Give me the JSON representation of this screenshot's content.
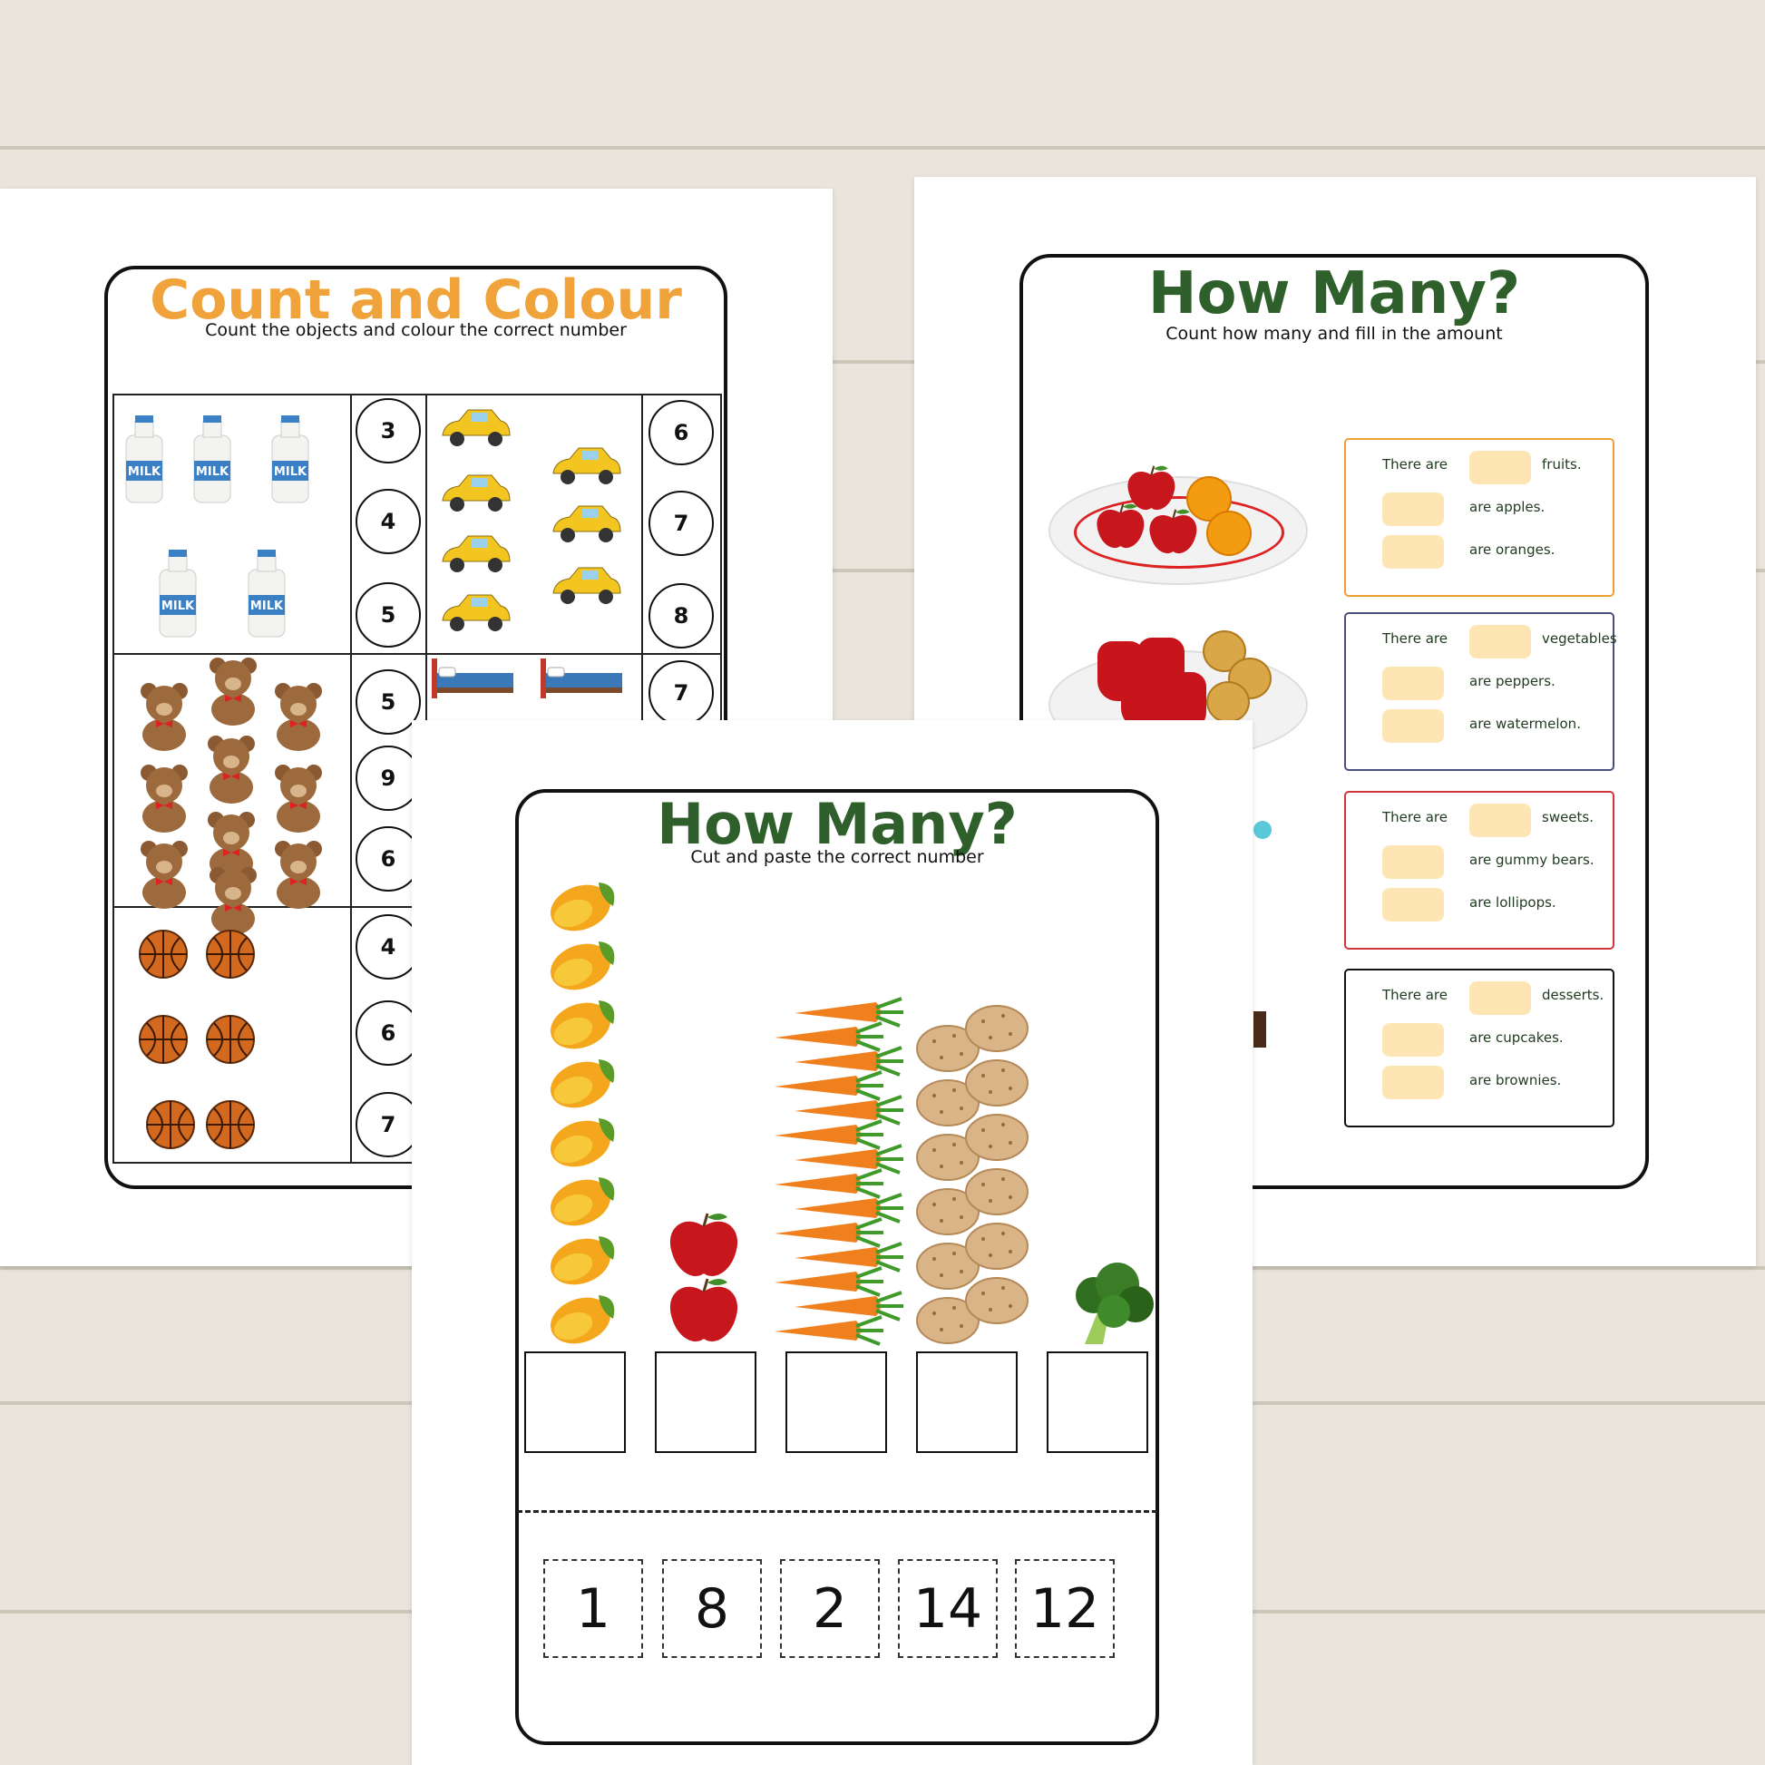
{
  "colors": {
    "orange_title": "#f0a33a",
    "green_title": "#2f5f2b",
    "box_orange": "#f0a030",
    "box_navy": "#4a4e7a",
    "box_red": "#d0343c",
    "box_black": "#111111",
    "pill": "#fde6b3"
  },
  "left_sheet": {
    "title": "Count and Colour",
    "subtitle": "Count the objects and colour the correct number",
    "rows": [
      {
        "left_item": "milk",
        "left_count": 5,
        "left_options": [
          "3",
          "4",
          "5"
        ],
        "right_item": "car",
        "right_count": 7,
        "right_options": [
          "6",
          "7",
          "8"
        ]
      },
      {
        "left_item": "teddy-bear",
        "left_count": 10,
        "left_options": [
          "5",
          "9",
          "6"
        ],
        "right_item": "bed",
        "right_count": 2,
        "right_options": [
          "7"
        ]
      },
      {
        "left_item": "basketball",
        "left_count": 6,
        "left_options": [
          "4",
          "6",
          "7"
        ]
      }
    ],
    "milk_label": "MILK"
  },
  "right_sheet": {
    "title": "How Many?",
    "subtitle": "Count how many and fill in the amount",
    "groups": [
      {
        "color": "#f0a030",
        "lead": "There are",
        "total_label": "fruits.",
        "lines": [
          "are apples.",
          "are oranges."
        ]
      },
      {
        "color": "#4a4e7a",
        "lead": "There are",
        "total_label": "vegetables",
        "lines": [
          "are peppers.",
          "are watermelon."
        ]
      },
      {
        "color": "#d0343c",
        "lead": "There are",
        "total_label": "sweets.",
        "lines": [
          "are gummy bears.",
          "are lollipops."
        ]
      },
      {
        "color": "#111111",
        "lead": "There are",
        "total_label": "desserts.",
        "lines": [
          "are cupcakes.",
          "are brownies."
        ]
      }
    ]
  },
  "front_sheet": {
    "title": "How Many?",
    "subtitle": "Cut and paste the correct number",
    "stacks": [
      {
        "item": "mango",
        "count": 8
      },
      {
        "item": "apple",
        "count": 2
      },
      {
        "item": "carrot",
        "count": 14
      },
      {
        "item": "potato",
        "count": 12
      },
      {
        "item": "broccoli",
        "count": 1
      }
    ],
    "cutout_numbers": [
      "1",
      "8",
      "2",
      "14",
      "12"
    ]
  }
}
